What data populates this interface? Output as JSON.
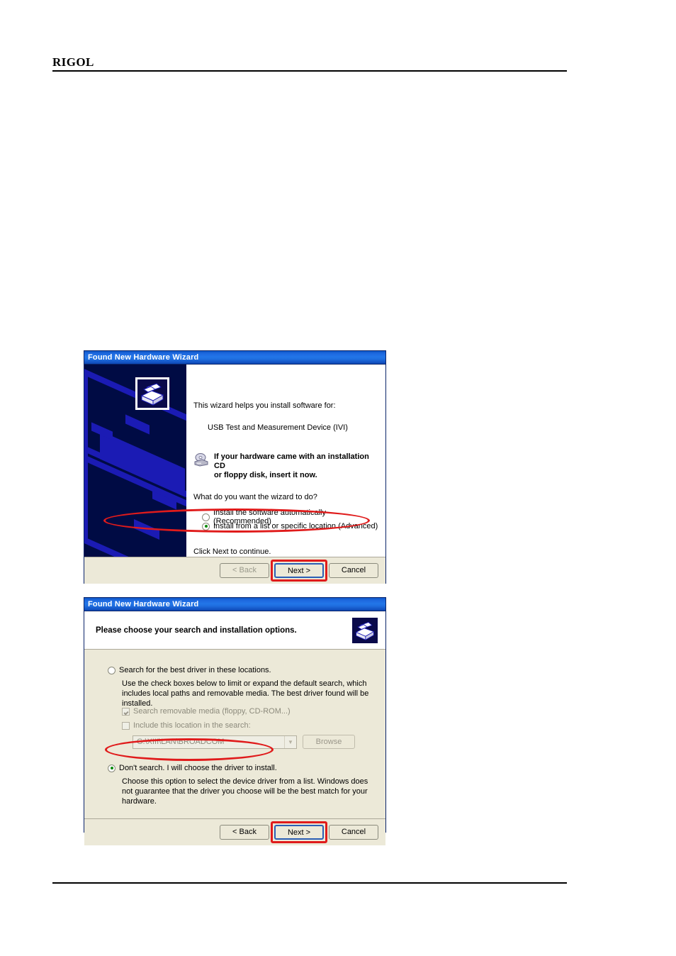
{
  "page": {
    "brand": "RIGOL"
  },
  "dialog1": {
    "title": "Found New Hardware Wizard",
    "intro": "This wizard helps you install software for:",
    "device": "USB Test and Measurement Device (IVI)",
    "cd_note_line1": "If your hardware came with an installation CD",
    "cd_note_line2": "or floppy disk, insert it now.",
    "question": "What do you want the wizard to do?",
    "options": [
      {
        "label": "Install the software automatically (Recommended)",
        "selected": false
      },
      {
        "label": "Install from a list or specific location (Advanced)",
        "selected": true
      }
    ],
    "click_next": "Click Next to continue.",
    "buttons": {
      "back": "< Back",
      "next": "Next >",
      "cancel": "Cancel"
    }
  },
  "dialog2": {
    "title": "Found New Hardware Wizard",
    "heading": "Please choose your search and installation options.",
    "option1": {
      "label": "Search for the best driver in these locations.",
      "selected": false,
      "description": "Use the check boxes below to limit or expand the default search, which includes local paths and removable media. The best driver found will be installed."
    },
    "checkboxes": [
      {
        "label": "Search removable media (floppy, CD-ROM...)",
        "checked": true
      },
      {
        "label": "Include this location in the search:",
        "checked": false
      }
    ],
    "location_value": "G:\\XIII\\LAN\\BROADCOM",
    "browse_label": "Browse",
    "option2": {
      "label": "Don't search. I will choose the driver to install.",
      "selected": true,
      "description": "Choose this option to select the device driver from a list. Windows does not guarantee that the driver you choose will be the best match for your hardware."
    },
    "buttons": {
      "back": "< Back",
      "next": "Next >",
      "cancel": "Cancel"
    }
  },
  "annotations": {
    "accent_color": "#e01b1b"
  }
}
